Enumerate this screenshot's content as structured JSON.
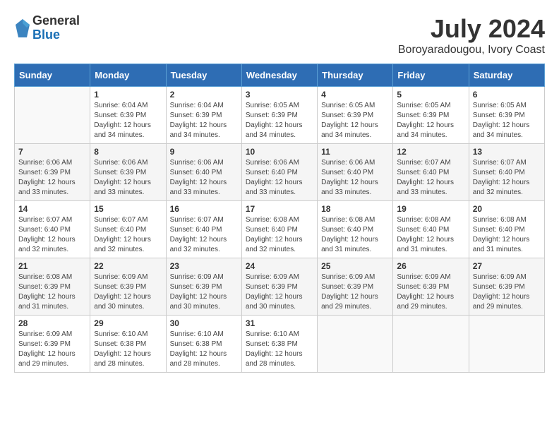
{
  "header": {
    "logo_general": "General",
    "logo_blue": "Blue",
    "month_year": "July 2024",
    "location": "Boroyaradougou, Ivory Coast"
  },
  "days_of_week": [
    "Sunday",
    "Monday",
    "Tuesday",
    "Wednesday",
    "Thursday",
    "Friday",
    "Saturday"
  ],
  "weeks": [
    [
      {
        "day": "",
        "sunrise": "",
        "sunset": "",
        "daylight": "",
        "minutes": ""
      },
      {
        "day": "1",
        "sunrise": "Sunrise: 6:04 AM",
        "sunset": "Sunset: 6:39 PM",
        "daylight": "Daylight: 12 hours",
        "minutes": "and 34 minutes."
      },
      {
        "day": "2",
        "sunrise": "Sunrise: 6:04 AM",
        "sunset": "Sunset: 6:39 PM",
        "daylight": "Daylight: 12 hours",
        "minutes": "and 34 minutes."
      },
      {
        "day": "3",
        "sunrise": "Sunrise: 6:05 AM",
        "sunset": "Sunset: 6:39 PM",
        "daylight": "Daylight: 12 hours",
        "minutes": "and 34 minutes."
      },
      {
        "day": "4",
        "sunrise": "Sunrise: 6:05 AM",
        "sunset": "Sunset: 6:39 PM",
        "daylight": "Daylight: 12 hours",
        "minutes": "and 34 minutes."
      },
      {
        "day": "5",
        "sunrise": "Sunrise: 6:05 AM",
        "sunset": "Sunset: 6:39 PM",
        "daylight": "Daylight: 12 hours",
        "minutes": "and 34 minutes."
      },
      {
        "day": "6",
        "sunrise": "Sunrise: 6:05 AM",
        "sunset": "Sunset: 6:39 PM",
        "daylight": "Daylight: 12 hours",
        "minutes": "and 34 minutes."
      }
    ],
    [
      {
        "day": "7",
        "sunrise": "Sunrise: 6:06 AM",
        "sunset": "Sunset: 6:39 PM",
        "daylight": "Daylight: 12 hours",
        "minutes": "and 33 minutes."
      },
      {
        "day": "8",
        "sunrise": "Sunrise: 6:06 AM",
        "sunset": "Sunset: 6:39 PM",
        "daylight": "Daylight: 12 hours",
        "minutes": "and 33 minutes."
      },
      {
        "day": "9",
        "sunrise": "Sunrise: 6:06 AM",
        "sunset": "Sunset: 6:40 PM",
        "daylight": "Daylight: 12 hours",
        "minutes": "and 33 minutes."
      },
      {
        "day": "10",
        "sunrise": "Sunrise: 6:06 AM",
        "sunset": "Sunset: 6:40 PM",
        "daylight": "Daylight: 12 hours",
        "minutes": "and 33 minutes."
      },
      {
        "day": "11",
        "sunrise": "Sunrise: 6:06 AM",
        "sunset": "Sunset: 6:40 PM",
        "daylight": "Daylight: 12 hours",
        "minutes": "and 33 minutes."
      },
      {
        "day": "12",
        "sunrise": "Sunrise: 6:07 AM",
        "sunset": "Sunset: 6:40 PM",
        "daylight": "Daylight: 12 hours",
        "minutes": "and 33 minutes."
      },
      {
        "day": "13",
        "sunrise": "Sunrise: 6:07 AM",
        "sunset": "Sunset: 6:40 PM",
        "daylight": "Daylight: 12 hours",
        "minutes": "and 32 minutes."
      }
    ],
    [
      {
        "day": "14",
        "sunrise": "Sunrise: 6:07 AM",
        "sunset": "Sunset: 6:40 PM",
        "daylight": "Daylight: 12 hours",
        "minutes": "and 32 minutes."
      },
      {
        "day": "15",
        "sunrise": "Sunrise: 6:07 AM",
        "sunset": "Sunset: 6:40 PM",
        "daylight": "Daylight: 12 hours",
        "minutes": "and 32 minutes."
      },
      {
        "day": "16",
        "sunrise": "Sunrise: 6:07 AM",
        "sunset": "Sunset: 6:40 PM",
        "daylight": "Daylight: 12 hours",
        "minutes": "and 32 minutes."
      },
      {
        "day": "17",
        "sunrise": "Sunrise: 6:08 AM",
        "sunset": "Sunset: 6:40 PM",
        "daylight": "Daylight: 12 hours",
        "minutes": "and 32 minutes."
      },
      {
        "day": "18",
        "sunrise": "Sunrise: 6:08 AM",
        "sunset": "Sunset: 6:40 PM",
        "daylight": "Daylight: 12 hours",
        "minutes": "and 31 minutes."
      },
      {
        "day": "19",
        "sunrise": "Sunrise: 6:08 AM",
        "sunset": "Sunset: 6:40 PM",
        "daylight": "Daylight: 12 hours",
        "minutes": "and 31 minutes."
      },
      {
        "day": "20",
        "sunrise": "Sunrise: 6:08 AM",
        "sunset": "Sunset: 6:40 PM",
        "daylight": "Daylight: 12 hours",
        "minutes": "and 31 minutes."
      }
    ],
    [
      {
        "day": "21",
        "sunrise": "Sunrise: 6:08 AM",
        "sunset": "Sunset: 6:39 PM",
        "daylight": "Daylight: 12 hours",
        "minutes": "and 31 minutes."
      },
      {
        "day": "22",
        "sunrise": "Sunrise: 6:09 AM",
        "sunset": "Sunset: 6:39 PM",
        "daylight": "Daylight: 12 hours",
        "minutes": "and 30 minutes."
      },
      {
        "day": "23",
        "sunrise": "Sunrise: 6:09 AM",
        "sunset": "Sunset: 6:39 PM",
        "daylight": "Daylight: 12 hours",
        "minutes": "and 30 minutes."
      },
      {
        "day": "24",
        "sunrise": "Sunrise: 6:09 AM",
        "sunset": "Sunset: 6:39 PM",
        "daylight": "Daylight: 12 hours",
        "minutes": "and 30 minutes."
      },
      {
        "day": "25",
        "sunrise": "Sunrise: 6:09 AM",
        "sunset": "Sunset: 6:39 PM",
        "daylight": "Daylight: 12 hours",
        "minutes": "and 29 minutes."
      },
      {
        "day": "26",
        "sunrise": "Sunrise: 6:09 AM",
        "sunset": "Sunset: 6:39 PM",
        "daylight": "Daylight: 12 hours",
        "minutes": "and 29 minutes."
      },
      {
        "day": "27",
        "sunrise": "Sunrise: 6:09 AM",
        "sunset": "Sunset: 6:39 PM",
        "daylight": "Daylight: 12 hours",
        "minutes": "and 29 minutes."
      }
    ],
    [
      {
        "day": "28",
        "sunrise": "Sunrise: 6:09 AM",
        "sunset": "Sunset: 6:39 PM",
        "daylight": "Daylight: 12 hours",
        "minutes": "and 29 minutes."
      },
      {
        "day": "29",
        "sunrise": "Sunrise: 6:10 AM",
        "sunset": "Sunset: 6:38 PM",
        "daylight": "Daylight: 12 hours",
        "minutes": "and 28 minutes."
      },
      {
        "day": "30",
        "sunrise": "Sunrise: 6:10 AM",
        "sunset": "Sunset: 6:38 PM",
        "daylight": "Daylight: 12 hours",
        "minutes": "and 28 minutes."
      },
      {
        "day": "31",
        "sunrise": "Sunrise: 6:10 AM",
        "sunset": "Sunset: 6:38 PM",
        "daylight": "Daylight: 12 hours",
        "minutes": "and 28 minutes."
      },
      {
        "day": "",
        "sunrise": "",
        "sunset": "",
        "daylight": "",
        "minutes": ""
      },
      {
        "day": "",
        "sunrise": "",
        "sunset": "",
        "daylight": "",
        "minutes": ""
      },
      {
        "day": "",
        "sunrise": "",
        "sunset": "",
        "daylight": "",
        "minutes": ""
      }
    ]
  ]
}
